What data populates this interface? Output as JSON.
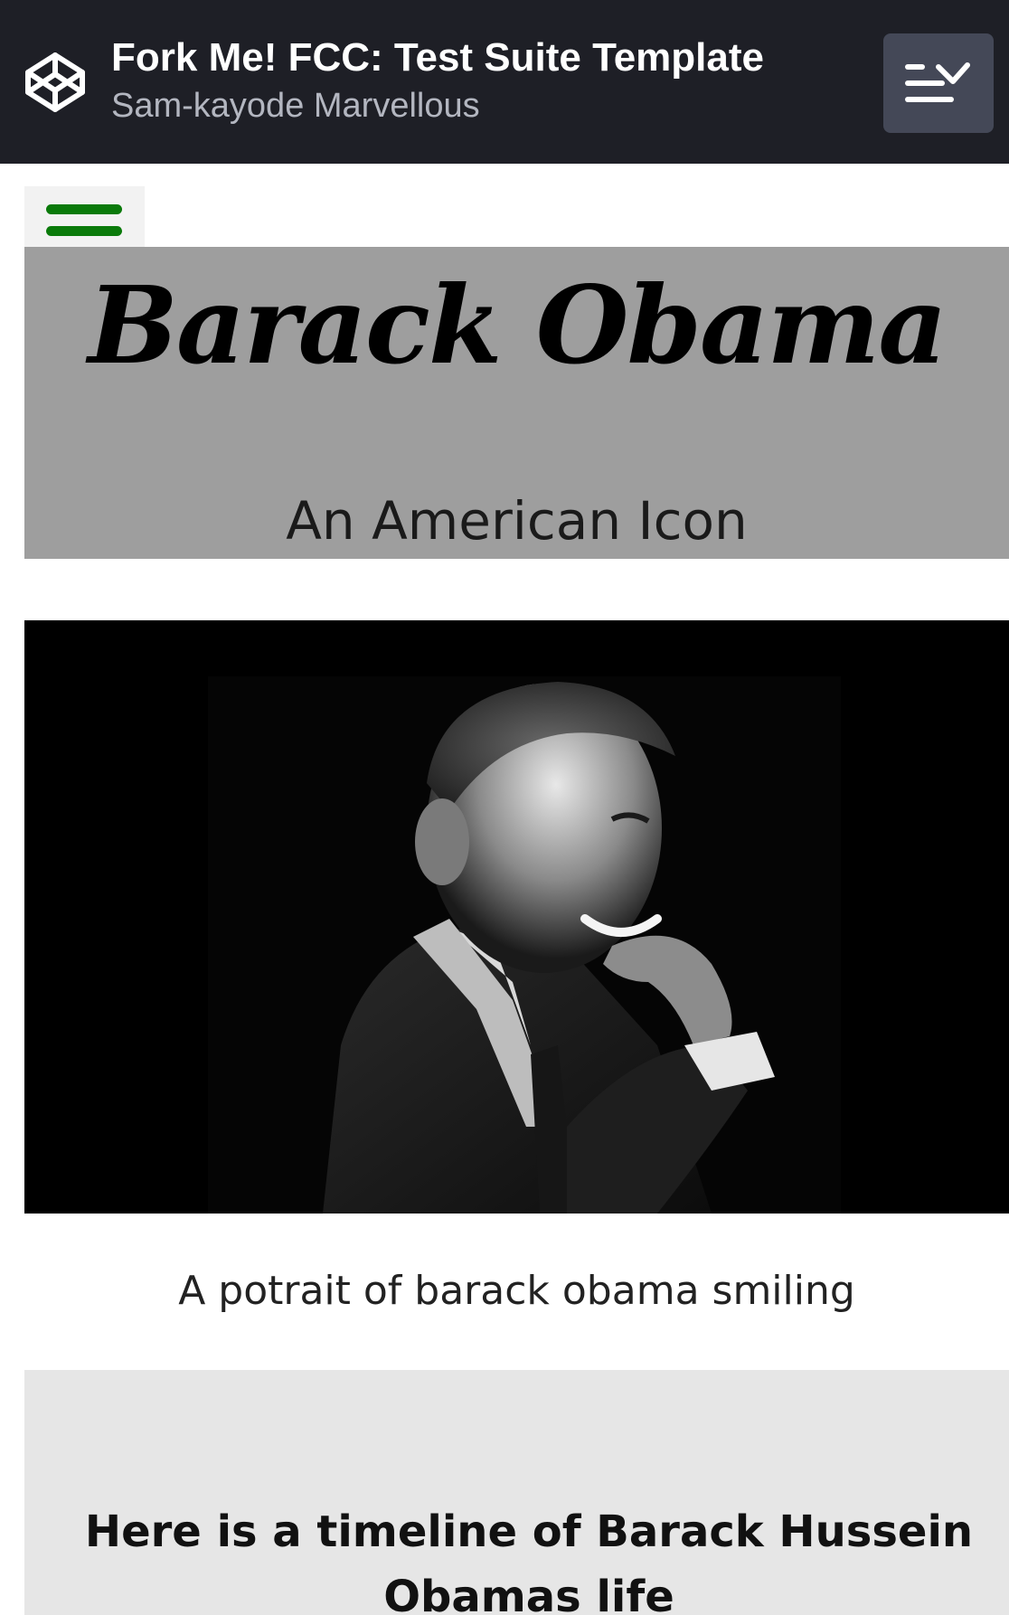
{
  "header": {
    "pen_title": "Fork Me! FCC: Test Suite Template",
    "author": "Sam-kayode Marvellous",
    "logo_icon": "codepen-cube-icon",
    "details_icon": "collapse-details-icon"
  },
  "page": {
    "menu_icon": "hamburger-menu-icon",
    "menu_color": "#0a7a0a",
    "hero": {
      "title": "Barack Obama",
      "subtitle": "An American Icon"
    },
    "image": {
      "alt": "portrait of barack obama smiling",
      "caption": "A potrait of barack obama smiling"
    },
    "timeline": {
      "heading": "Here is a timeline of Barack Hussein Obamas life"
    }
  }
}
